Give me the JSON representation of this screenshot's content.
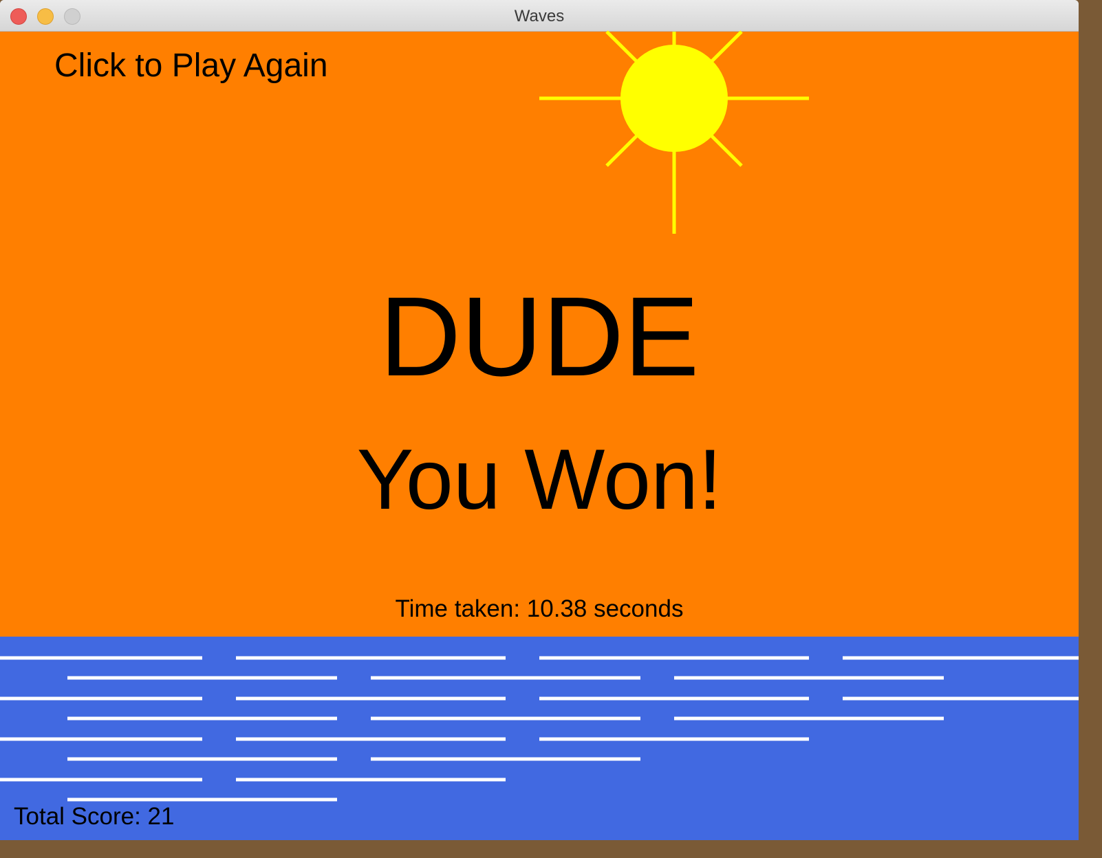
{
  "window": {
    "title": "Waves"
  },
  "game": {
    "play_again_label": "Click to Play Again",
    "headline": "DUDE",
    "result": "You Won!",
    "time_taken": "Time taken: 10.38 seconds",
    "total_score": "Total Score: 21"
  },
  "colors": {
    "sky": "#ff7f00",
    "sea": "#4169e1",
    "sun": "#ffff00",
    "wave": "#ffffff",
    "text": "#000000"
  },
  "icons": {
    "sun": "sun-icon",
    "waves": "wave-lines"
  }
}
